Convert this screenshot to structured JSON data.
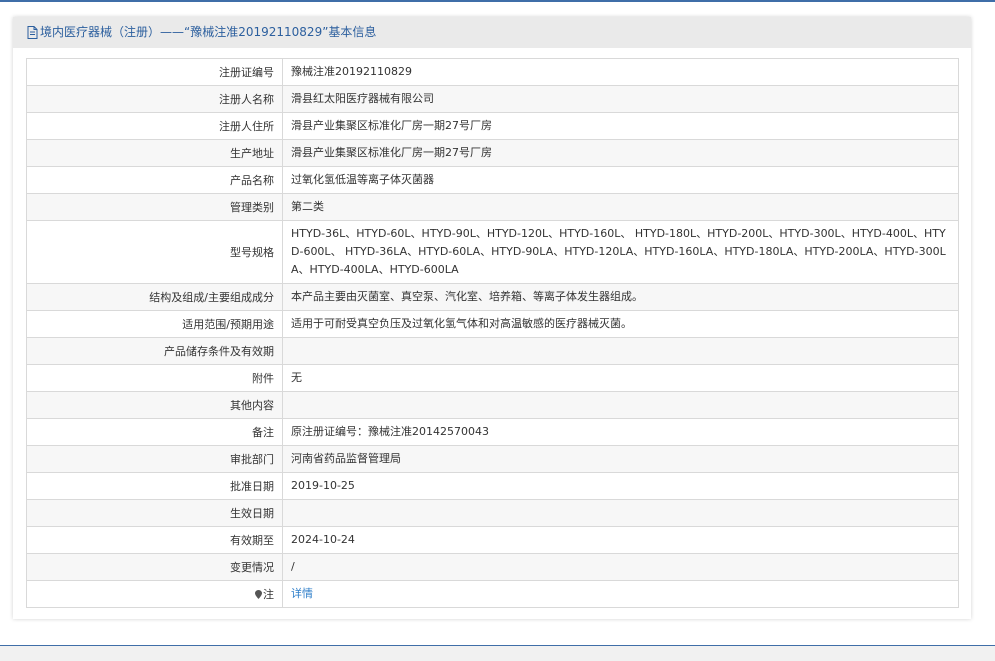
{
  "header": {
    "icon": "document-icon",
    "title": "境内医疗器械（注册）——“豫械注准20192110829”基本信息"
  },
  "rows": [
    {
      "label": "注册证编号",
      "value": "豫械注准20192110829"
    },
    {
      "label": "注册人名称",
      "value": "滑县红太阳医疗器械有限公司"
    },
    {
      "label": "注册人住所",
      "value": "滑县产业集聚区标准化厂房一期27号厂房"
    },
    {
      "label": "生产地址",
      "value": "滑县产业集聚区标准化厂房一期27号厂房"
    },
    {
      "label": "产品名称",
      "value": "过氧化氢低温等离子体灭菌器"
    },
    {
      "label": "管理类别",
      "value": "第二类"
    },
    {
      "label": "型号规格",
      "value": "HTYD-36L、HTYD-60L、HTYD-90L、HTYD-120L、HTYD-160L、 HTYD-180L、HTYD-200L、HTYD-300L、HTYD-400L、HTYD-600L、 HTYD-36LA、HTYD-60LA、HTYD-90LA、HTYD-120LA、HTYD-160LA、HTYD-180LA、HTYD-200LA、HTYD-300LA、HTYD-400LA、HTYD-600LA"
    },
    {
      "label": "结构及组成/主要组成成分",
      "value": "本产品主要由灭菌室、真空泵、汽化室、培养箱、等离子体发生器组成。"
    },
    {
      "label": "适用范围/预期用途",
      "value": "适用于可耐受真空负压及过氧化氢气体和对高温敏感的医疗器械灭菌。"
    },
    {
      "label": "产品储存条件及有效期",
      "value": ""
    },
    {
      "label": "附件",
      "value": "无"
    },
    {
      "label": "其他内容",
      "value": ""
    },
    {
      "label": "备注",
      "value": "原注册证编号：豫械注准20142570043"
    },
    {
      "label": "审批部门",
      "value": "河南省药品监督管理局"
    },
    {
      "label": "批准日期",
      "value": "2019-10-25"
    },
    {
      "label": "生效日期",
      "value": ""
    },
    {
      "label": "有效期至",
      "value": "2024-10-24"
    },
    {
      "label": "变更情况",
      "value": "/"
    },
    {
      "label": "注",
      "value": "详情",
      "icon": "pin-icon"
    }
  ]
}
